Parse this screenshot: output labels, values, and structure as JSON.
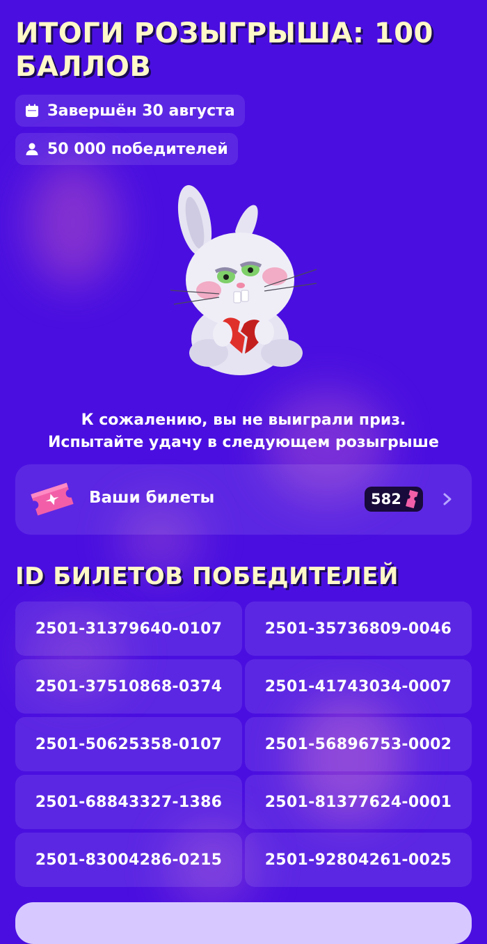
{
  "header": {
    "title": "ИТОГИ РОЗЫГРЫША: 100 БАЛЛОВ",
    "chips": [
      {
        "icon": "calendar-icon",
        "text": "Завершён 30 августа"
      },
      {
        "icon": "user-icon",
        "text": "50 000 победителей"
      }
    ]
  },
  "result": {
    "line1": "К сожалению, вы не выиграли приз.",
    "line2": "Испытайте удачу в следующем розыгрыше"
  },
  "tickets": {
    "label": "Ваши билеты",
    "count": "582",
    "icon": "ticket-icon"
  },
  "winners": {
    "title": "ID БИЛЕТОВ ПОБЕДИТЕЛЕЙ",
    "ids": [
      "2501-31379640-0107",
      "2501-35736809-0046",
      "2501-37510868-0374",
      "2501-41743034-0007",
      "2501-50625358-0107",
      "2501-56896753-0002",
      "2501-68843327-1386",
      "2501-81377624-0001",
      "2501-83004286-0215",
      "2501-92804261-0025"
    ]
  },
  "colors": {
    "background": "#4a0fe0",
    "title": "#fff8c8",
    "card": "rgba(255,255,255,0.10)",
    "ticket_pink": "#f25fa8"
  }
}
